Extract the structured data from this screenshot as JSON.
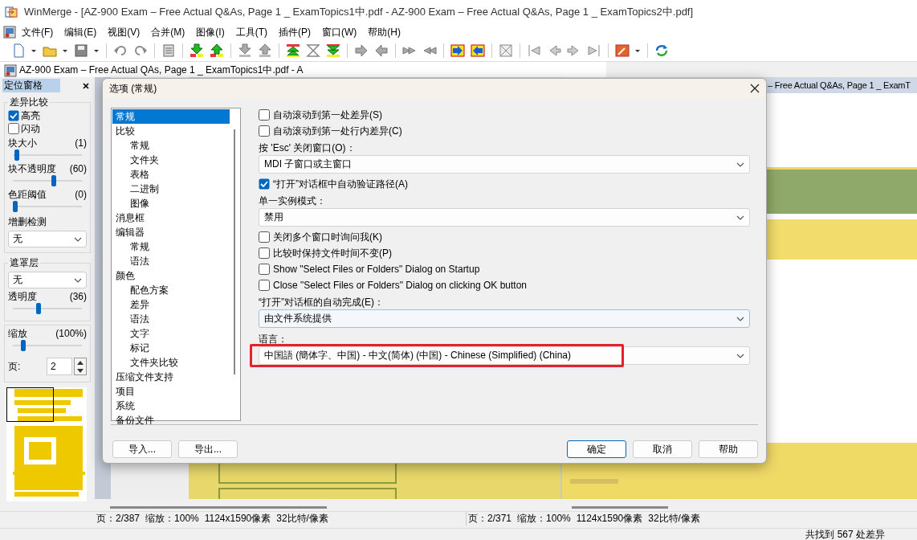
{
  "window": {
    "title": "WinMerge - [AZ-900 Exam – Free Actual Q&As, Page 1 _ ExamTopics1中.pdf - AZ-900 Exam – Free Actual Q&As, Page 1 _ ExamTopics2中.pdf]"
  },
  "menu": [
    "文件(F)",
    "编辑(E)",
    "视图(V)",
    "合并(M)",
    "图像(I)",
    "工具(T)",
    "插件(P)",
    "窗口(W)",
    "帮助(H)"
  ],
  "child_window": {
    "title": "AZ-900 Exam – Free Actual QAs, Page 1 _ ExamTopics1中.pdf - A"
  },
  "location_pane": {
    "title": "定位窗格",
    "groups": [
      {
        "title": "差异比较",
        "items": [
          {
            "kind": "checkbox",
            "label": "高亮",
            "checked": true
          },
          {
            "kind": "checkbox",
            "label": "闪动",
            "checked": false
          },
          {
            "kind": "slider",
            "label": "块大小",
            "reading": "(1)",
            "level": 0.03
          },
          {
            "kind": "slider",
            "label": "块不透明度",
            "reading": "(60)",
            "level": 0.6
          },
          {
            "kind": "slider",
            "label": "色距阈值",
            "reading": "(0)",
            "level": 0.0
          },
          {
            "kind": "select",
            "label": "增删检测",
            "value": "无"
          }
        ]
      },
      {
        "title": "遮罩层",
        "items": [
          {
            "kind": "select",
            "value": "无"
          },
          {
            "kind": "slider",
            "label": "透明度",
            "reading": "(36)",
            "level": 0.36
          }
        ]
      },
      {
        "items": [
          {
            "kind": "slider",
            "label": "缩放",
            "reading": "(100%)",
            "level": 0.13
          },
          {
            "kind": "spinner",
            "label": "页:",
            "value": "2"
          }
        ]
      }
    ]
  },
  "right_pane": {
    "title": "– Free Actual Q&As, Page 1 _ ExamT"
  },
  "status": [
    {
      "items": [
        "页：2/387",
        "缩放：100%",
        "1124x1590像素",
        "32比特/像素"
      ]
    },
    {
      "items": [
        "页：2/371",
        "缩放：100%",
        "1124x1590像素",
        "32比特/像素"
      ]
    }
  ],
  "summary": "共找到 567 处差异",
  "dialog": {
    "title": "选项 (常规)",
    "tree": [
      {
        "label": "常规",
        "selected": true
      },
      {
        "label": "比较",
        "selected": false,
        "children": [
          {
            "label": "常规",
            "selected": false
          },
          {
            "label": "文件夹",
            "selected": false
          },
          {
            "label": "表格",
            "selected": false
          },
          {
            "label": "二进制",
            "selected": false
          },
          {
            "label": "图像",
            "selected": false
          }
        ]
      },
      {
        "label": "消息框",
        "selected": false
      },
      {
        "label": "编辑器",
        "selected": false,
        "children": [
          {
            "label": "常规",
            "selected": false
          },
          {
            "label": "语法",
            "selected": false
          }
        ]
      },
      {
        "label": "颜色",
        "selected": false,
        "children": [
          {
            "label": "配色方案",
            "selected": false
          },
          {
            "label": "差异",
            "selected": false
          },
          {
            "label": "语法",
            "selected": false
          },
          {
            "label": "文字",
            "selected": false
          },
          {
            "label": "标记",
            "selected": false
          },
          {
            "label": "文件夹比较",
            "selected": false
          }
        ]
      },
      {
        "label": "压缩文件支持",
        "selected": false
      },
      {
        "label": "项目",
        "selected": false
      },
      {
        "label": "系统",
        "selected": false
      },
      {
        "label": "备份文件",
        "selected": false
      }
    ],
    "options": [
      {
        "kind": "checkbox",
        "label": "自动滚动到第一处差异(S)",
        "checked": false
      },
      {
        "kind": "checkbox",
        "label": "自动滚动到第一处行内差异(C)",
        "checked": false
      },
      {
        "kind": "label",
        "label": "按 'Esc' 关闭窗口(O)："
      },
      {
        "kind": "select",
        "value": "MDI 子窗口或主窗口",
        "focused": false,
        "highlighted": false
      },
      {
        "kind": "checkbox",
        "label": "“打开”对话框中自动验证路径(A)",
        "checked": true
      },
      {
        "kind": "label",
        "label": "单一实例模式："
      },
      {
        "kind": "select",
        "value": "禁用",
        "focused": false,
        "highlighted": false
      },
      {
        "kind": "checkbox",
        "label": "关闭多个窗口时询问我(K)",
        "checked": false
      },
      {
        "kind": "checkbox",
        "label": "比较时保持文件时间不变(P)",
        "checked": false
      },
      {
        "kind": "checkbox",
        "label": "Show \"Select Files or Folders\" Dialog on Startup",
        "checked": false
      },
      {
        "kind": "checkbox",
        "label": "Close \"Select Files or Folders\" Dialog on clicking OK button",
        "checked": false
      },
      {
        "kind": "label",
        "label": "“打开”对话框的自动完成(E)："
      },
      {
        "kind": "select",
        "value": "由文件系统提供",
        "focused": true,
        "highlighted": false
      },
      {
        "kind": "label",
        "label": "语言："
      },
      {
        "kind": "select",
        "value": "中国語 (簡体字、中国) - 中文(简体) (中国) - Chinese (Simplified) (China)",
        "focused": false,
        "highlighted": true
      }
    ],
    "left_buttons": [
      {
        "label": "导入...",
        "default": false
      },
      {
        "label": "导出...",
        "default": false
      }
    ],
    "right_buttons": [
      {
        "label": "确定",
        "default": true
      },
      {
        "label": "取消",
        "default": false
      },
      {
        "label": "帮助",
        "default": false
      }
    ]
  }
}
